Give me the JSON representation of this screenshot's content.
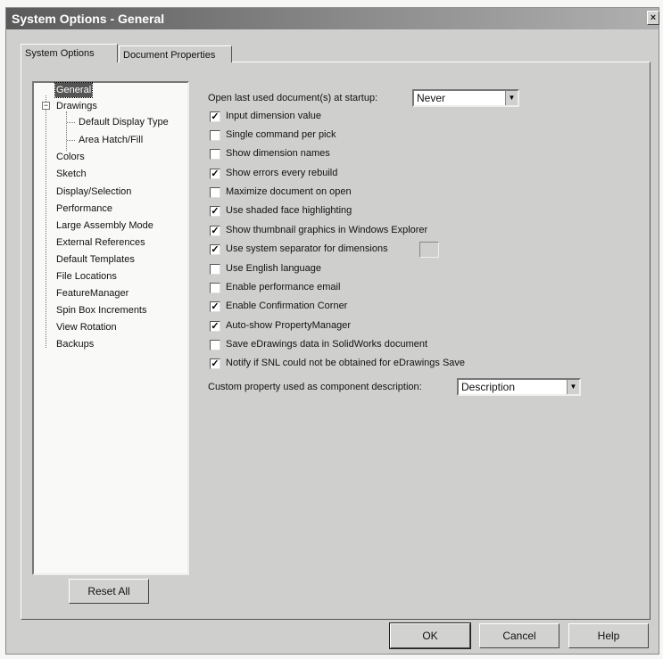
{
  "window": {
    "title": "System Options - General",
    "close_glyph": "×"
  },
  "tabs": [
    {
      "label": "System Options",
      "active": true
    },
    {
      "label": "Document Properties",
      "active": false
    }
  ],
  "tree": {
    "items": [
      {
        "label": "General",
        "selected": true
      },
      {
        "label": "Drawings",
        "expanded": true
      },
      {
        "label": "Default Display Type",
        "child": true
      },
      {
        "label": "Area Hatch/Fill",
        "child": true
      },
      {
        "label": "Colors"
      },
      {
        "label": "Sketch"
      },
      {
        "label": "Display/Selection"
      },
      {
        "label": "Performance"
      },
      {
        "label": "Large Assembly Mode"
      },
      {
        "label": "External References"
      },
      {
        "label": "Default Templates"
      },
      {
        "label": "File Locations"
      },
      {
        "label": "FeatureManager"
      },
      {
        "label": "Spin Box Increments"
      },
      {
        "label": "View Rotation"
      },
      {
        "label": "Backups"
      }
    ],
    "expander_glyph": "−"
  },
  "open_last": {
    "label": "Open last used document(s) at startup:",
    "value": "Never"
  },
  "checkboxes": [
    {
      "label": "Input dimension value",
      "checked": true
    },
    {
      "label": "Single command per pick",
      "checked": false
    },
    {
      "label": "Show dimension names",
      "checked": false
    },
    {
      "label": "Show errors every rebuild",
      "checked": true
    },
    {
      "label": "Maximize document on open",
      "checked": false
    },
    {
      "label": "Use shaded face highlighting",
      "checked": true
    },
    {
      "label": "Show thumbnail graphics in Windows Explorer",
      "checked": true
    },
    {
      "label": "Use system separator for dimensions",
      "checked": true
    },
    {
      "label": "Use English language",
      "checked": false
    },
    {
      "label": "Enable performance email",
      "checked": false
    },
    {
      "label": "Enable Confirmation Corner",
      "checked": true
    },
    {
      "label": "Auto-show PropertyManager",
      "checked": true
    },
    {
      "label": "Save eDrawings data in SolidWorks document",
      "checked": false
    },
    {
      "label": "Notify if SNL could not be obtained for eDrawings Save",
      "checked": true
    }
  ],
  "check_glyph": "✓",
  "dropdown_arrow": "▼",
  "custom_property": {
    "label": "Custom property used as component description:",
    "value": "Description"
  },
  "buttons": {
    "reset_all": "Reset All",
    "ok": "OK",
    "cancel": "Cancel",
    "help": "Help"
  }
}
